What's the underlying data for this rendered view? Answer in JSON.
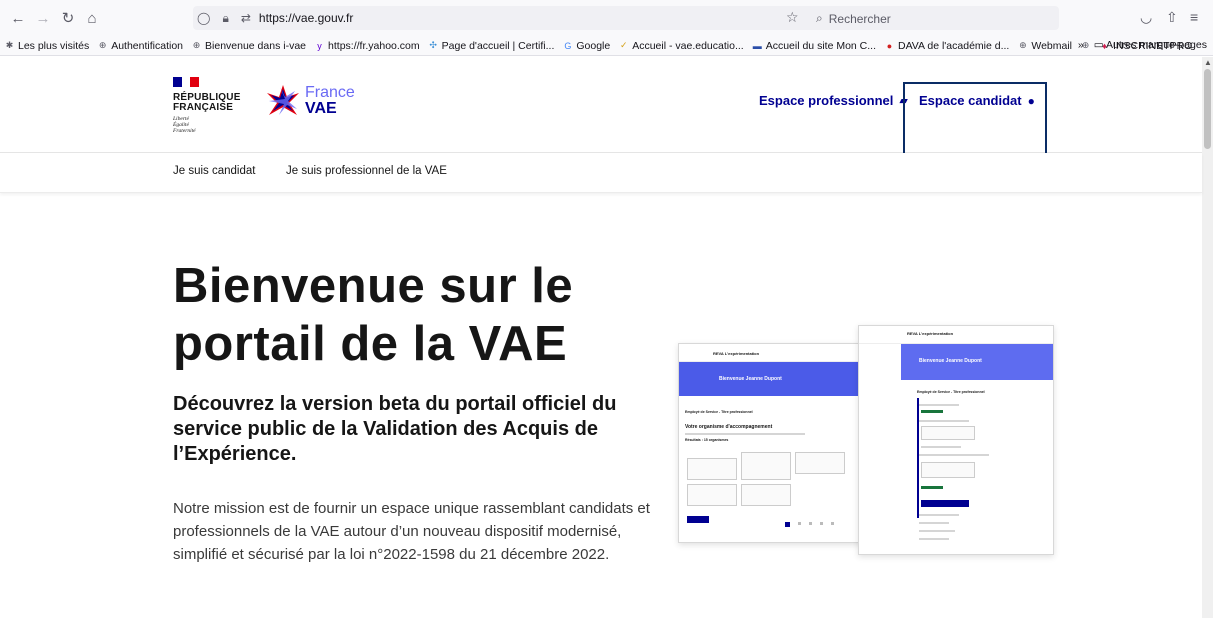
{
  "browser": {
    "url_host": "https://vae.gouv.fr",
    "search_placeholder": "Rechercher",
    "bookmarks": [
      {
        "label": "Les plus visités",
        "icon": "gear-icon",
        "color": "#5b5b66"
      },
      {
        "label": "Authentification",
        "icon": "globe-icon",
        "color": "#5b5b66"
      },
      {
        "label": "Bienvenue dans i-vae",
        "icon": "globe-icon",
        "color": "#5b5b66"
      },
      {
        "label": "https://fr.yahoo.com",
        "icon": "yahoo-icon",
        "color": "#6001d2"
      },
      {
        "label": "Page d'accueil | Certifi...",
        "icon": "certif-icon",
        "color": "#3b8fd6"
      },
      {
        "label": "Google",
        "icon": "google-icon",
        "color": "#4285f4"
      },
      {
        "label": "Accueil - vae.educatio...",
        "icon": "edu-icon",
        "color": "#d4a017"
      },
      {
        "label": "Accueil du site Mon C...",
        "icon": "moncompte-icon",
        "color": "#2a4ea8"
      },
      {
        "label": "DAVA de l'académie d...",
        "icon": "dava-icon",
        "color": "#d22020"
      },
      {
        "label": "Webmail",
        "icon": "globe-icon",
        "color": "#5b5b66"
      },
      {
        "label": "",
        "icon": "globe-icon",
        "color": "#5b5b66"
      },
      {
        "label": "INSCRINETPRO",
        "icon": "inscrinet-icon",
        "color": "#d02050"
      }
    ],
    "other_bookmarks": "Autres marque-pages"
  },
  "header": {
    "rf_title_1": "RÉPUBLIQUE",
    "rf_title_2": "FRANÇAISE",
    "rf_motto_1": "Liberté",
    "rf_motto_2": "Égalité",
    "rf_motto_3": "Fraternité",
    "brand_france": "France",
    "brand_vae": "VAE",
    "pro_link": "Espace professionnel",
    "candidate_link": "Espace candidat"
  },
  "subnav": {
    "item_1": "Je suis candidat",
    "item_2": "Je suis professionnel de la VAE"
  },
  "hero": {
    "title": "Bienvenue sur le portail de la VAE",
    "subtitle": "Découvrez la version beta du portail officiel du service public de la Validation des Acquis de l’Expérience.",
    "body": "Notre mission est de fournir un espace unique rassemblant candidats et professionnels de la VAE autour d’un nouveau dispositif modernisé, simplifié et sécurisé par la loi n°2022-1598 du 21 décembre 2022."
  },
  "mockup": {
    "app_name": "REVA L'expérimentation",
    "greeting": "Bienvenue Jeanne Dupont",
    "diploma": "Employé de Service - Titre professionnel",
    "org_title": "Votre organisme d'accompagnement",
    "results": "Résultats : 15 organismes"
  },
  "colors": {
    "brand_blue": "#000091",
    "accent_blue": "#6a6af4",
    "flag_red": "#e1000f"
  }
}
